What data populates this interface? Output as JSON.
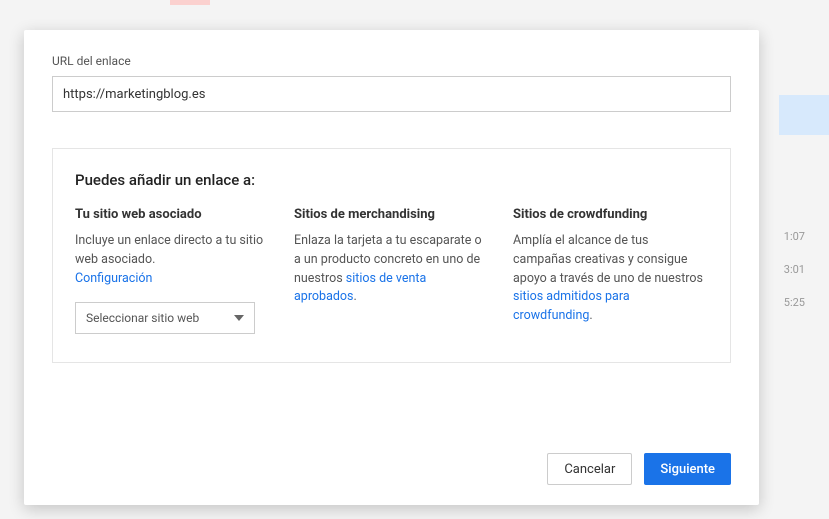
{
  "dialog": {
    "url_label": "URL del enlace",
    "url_value": "https://marketingblog.es",
    "heading": "Puedes añadir un enlace a:",
    "columns": {
      "associated": {
        "title": "Tu sitio web asociado",
        "text_pre": "Incluye un enlace directo a tu sitio web asociado. ",
        "link": "Configuración",
        "dropdown_label": "Seleccionar sitio web"
      },
      "merch": {
        "title": "Sitios de merchandising",
        "text_pre": "Enlaza la tarjeta a tu escaparate o a un producto concreto en uno de nuestros ",
        "link": "sitios de venta aprobados",
        "text_post": "."
      },
      "crowd": {
        "title": "Sitios de crowdfunding",
        "text_pre": "Amplía el alcance de tus campañas creativas y consigue apoyo a través de uno de nuestros ",
        "link": "sitios admitidos para crowdfunding",
        "text_post": "."
      }
    },
    "footer": {
      "cancel": "Cancelar",
      "next": "Siguiente"
    }
  },
  "background": {
    "timestamps": [
      "1:07",
      "3:01",
      "5:25"
    ]
  }
}
